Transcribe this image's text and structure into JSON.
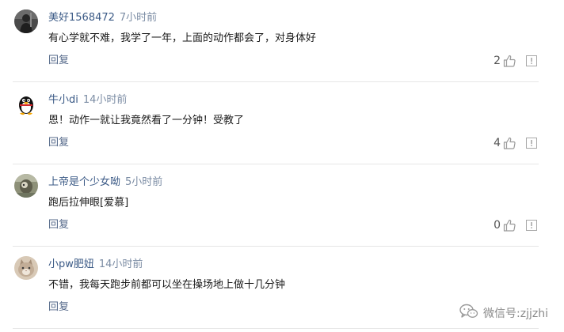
{
  "comments": [
    {
      "username": "美好1568472",
      "time": "7小时前",
      "text": "有心学就不难，我学了一年，上面的动作都会了，对身体好",
      "reply_label": "回复",
      "likes": "2",
      "avatar": "dark-figure-avatar"
    },
    {
      "username": "牛小di",
      "time": "14小时前",
      "text": "恩！动作一就让我竟然看了一分钟！受教了",
      "reply_label": "回复",
      "likes": "4",
      "avatar": "penguin-avatar"
    },
    {
      "username": "上帝是个少女呦",
      "time": "5小时前",
      "text": "跑后拉伸眼[爱慕]",
      "reply_label": "回复",
      "likes": "0",
      "avatar": "photo-avatar"
    },
    {
      "username": "小pw肥妞",
      "time": "14小时前",
      "text": "不错，我每天跑步前都可以坐在操场地上做十几分钟",
      "reply_label": "回复",
      "likes": "",
      "avatar": "cat-avatar"
    }
  ],
  "watermark": {
    "text": "微信号:zjjzhi",
    "icon": "wechat-logo-icon"
  },
  "colors": {
    "username": "#3b5a86",
    "time": "#7b8ca4",
    "text": "#1a1a1a",
    "reply": "#55698a",
    "divider": "#e6e6e6"
  }
}
